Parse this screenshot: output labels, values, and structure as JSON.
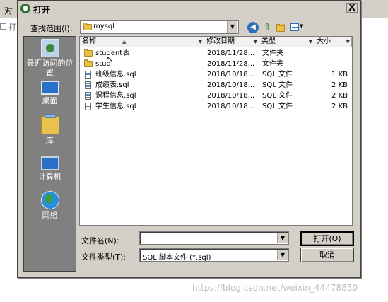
{
  "background": {
    "window_title_fragment": "对",
    "open_fragment": "打"
  },
  "dialog": {
    "title": "打开",
    "close_glyph": "X"
  },
  "toolbar": {
    "lookin_label": "查找范围(I):",
    "lookin_value": "mysql"
  },
  "places": [
    {
      "label": "最近访问的位置",
      "icon": "recent-places-icon"
    },
    {
      "label": "桌面",
      "icon": "desktop-icon"
    },
    {
      "label": "库",
      "icon": "library-icon"
    },
    {
      "label": "计算机",
      "icon": "computer-icon"
    },
    {
      "label": "网络",
      "icon": "network-icon"
    }
  ],
  "columns": {
    "name": "名称",
    "modified": "修改日期",
    "type": "类型",
    "size": "大小"
  },
  "files": [
    {
      "name": "student表",
      "modified": "2018/11/28...",
      "type": "文件夹",
      "size": "",
      "kind": "folder"
    },
    {
      "name": "stud",
      "modified": "2018/11/28...",
      "type": "文件夹",
      "size": "",
      "kind": "folder"
    },
    {
      "name": "班级信息.sql",
      "modified": "2018/10/18...",
      "type": "SQL 文件",
      "size": "1 KB",
      "kind": "sql"
    },
    {
      "name": "成绩表.sql",
      "modified": "2018/10/18...",
      "type": "SQL 文件",
      "size": "2 KB",
      "kind": "sql"
    },
    {
      "name": "课程信息.sql",
      "modified": "2018/10/18...",
      "type": "SQL 文件",
      "size": "2 KB",
      "kind": "sql"
    },
    {
      "name": "学生信息.sql",
      "modified": "2018/10/18...",
      "type": "SQL 文件",
      "size": "2 KB",
      "kind": "sql"
    }
  ],
  "bottom": {
    "filename_label": "文件名(N):",
    "filename_value": "",
    "filetype_label": "文件类型(T):",
    "filetype_value": "SQL 脚本文件 (*.sql)",
    "open_button": "打开(O)",
    "cancel_button": "取消"
  },
  "watermark": "https://blog.csdn.net/weixin_44478850"
}
